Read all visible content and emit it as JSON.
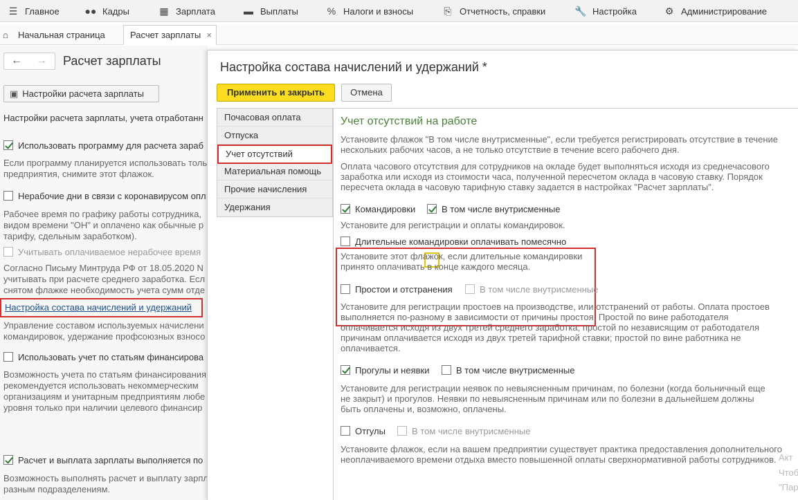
{
  "menu": [
    {
      "icon": "home-icon",
      "glyph": "☰",
      "label": "Главное"
    },
    {
      "icon": "people-icon",
      "glyph": "👥",
      "label": "Кадры"
    },
    {
      "icon": "calculator-icon",
      "glyph": "▦",
      "label": "Зарплата"
    },
    {
      "icon": "payments-icon",
      "glyph": "▬",
      "label": "Выплаты"
    },
    {
      "icon": "percent-icon",
      "glyph": "%",
      "label": "Налоги и взносы"
    },
    {
      "icon": "reports-icon",
      "glyph": "⎘",
      "label": "Отчетность, справки"
    },
    {
      "icon": "wrench-icon",
      "glyph": "🔧",
      "label": "Настройка"
    },
    {
      "icon": "gear-icon",
      "glyph": "⚙",
      "label": "Администрирование"
    }
  ],
  "tabs": {
    "home": "Начальная страница",
    "active": "Расчет зарплаты",
    "close": "×"
  },
  "left": {
    "title": "Расчет зарплаты",
    "settings_button": "Настройки расчета зарплаты",
    "intro": "Настройки расчета зарплаты, учета отработанн",
    "use_program": "Использовать программу для расчета зараб",
    "use_program_desc": [
      "Если программу планируется использовать толь",
      "предприятия, снимите этот флажок."
    ],
    "covid": "Нерабочие дни в связи с коронавирусом опл",
    "covid_desc": [
      "Рабочее время по графику работы сотрудника,",
      "видом времени \"ОН\" и оплачено как обычные р",
      "тарифу, сдельным заработком)."
    ],
    "paid_nonwork": "Учитывать оплачиваемое нерабочее время",
    "letter_desc": [
      "Согласно Письму Минтруда РФ от 18.05.2020 N",
      "учитывать при расчете среднего заработка. Есл",
      "снятом флажке необходимость учета сумм отде"
    ],
    "link": "Настройка состава начислений и удержаний",
    "link_desc": [
      "Управление составом используемых начислени",
      "командировок, удержание профсоюзных взносо"
    ],
    "financing": "Использовать учет по статьям финансирова",
    "financing_desc": [
      "Возможность учета по статьям финансирования",
      "рекомендуется использовать некоммерческим",
      "организациям и унитарным предприятиям любе",
      "уровня только при наличии целевого финансир"
    ],
    "departments": "Расчет и выплата зарплаты выполняется по",
    "departments_desc": [
      "Возможность выполнять расчет и выплату зарпл",
      "разным подразделениям."
    ]
  },
  "modal": {
    "title": "Настройка состава начислений и удержаний *",
    "apply": "Применить и закрыть",
    "cancel": "Отмена",
    "nav": [
      "Почасовая оплата",
      "Отпуска",
      "Учет отсутствий",
      "Материальная помощь",
      "Прочие начисления",
      "Удержания"
    ],
    "section_title": "Учет отсутствий на работе",
    "p1": [
      "Установите флажок \"В том числе внутрисменные\", если требуется регистрировать отсутствие в течение",
      "нескольких рабочих часов, а не только отсутствие в течение всего рабочего дня."
    ],
    "p2": [
      "Оплата часового отсутствия для сотрудников на окладе будет выполняться исходя из среднечасового",
      "заработка или исходя из стоимости часа, полученной пересчетом оклада в часовую ставку. Порядок",
      "пересчета оклада в часовую тарифную ставку задается в настройках \"Расчет зарплаты\"."
    ],
    "trips": "Командировки",
    "trips_inshift": "В том числе внутрисменные",
    "trips_desc": "Установите для регистрации и оплаты командировок.",
    "long_trips": "Длительные командировки оплачивать помесячно",
    "long_trips_desc": [
      "Установите этот флажок, если длительные командировки",
      "принято оплачивать в конце каждого месяца."
    ],
    "downtime": "Простои и отстранения",
    "downtime_inshift": "В том числе внутрисменные",
    "downtime_desc": [
      "Установите для регистрации простоев на производстве, или отстранений от работы. Оплата простоев",
      "выполняется по-разному в зависимости от причины простоя. Простой по вине работодателя",
      "оплачивается исходя из двух третей среднего заработка; простой по независящим от работодателя",
      "причинам оплачивается исходя из двух третей тарифной ставки; простой по вине работника не",
      "оплачивается."
    ],
    "truancy": "Прогулы и неявки",
    "truancy_inshift": "В том числе внутрисменные",
    "truancy_desc": [
      "Установите для регистрации неявок по невыясненным причинам, по болезни (когда больничный еще",
      "не закрыт) и прогулов. Неявки по невыясненным причинам или по болезни в дальнейшем должны",
      "быть оплачены и, возможно, оплачены."
    ],
    "timeoff": "Отгулы",
    "timeoff_inshift": "В том числе внутрисменные",
    "timeoff_desc": [
      "Установите флажок, если на вашем предприятии существует практика предоставления дополнительного",
      "неоплачиваемого времени отдыха вместо повышенной оплаты сверхнормативной работы сотрудников."
    ]
  },
  "watermark": [
    "Акт",
    "Чтоб",
    "\"Пар"
  ]
}
